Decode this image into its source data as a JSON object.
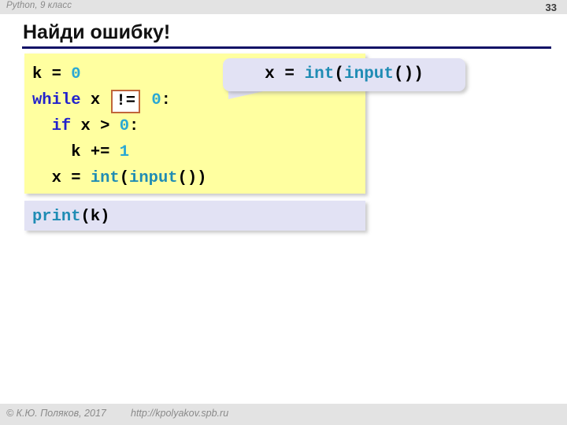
{
  "header": {
    "course_title": "Python, 9 класс",
    "page_number": "33"
  },
  "slide": {
    "title": "Найди ошибку!"
  },
  "code_main": {
    "lines": [
      {
        "indent": "",
        "tokens": [
          {
            "text": "k = ",
            "type": "plain"
          },
          {
            "text": "0",
            "type": "num"
          }
        ]
      },
      {
        "indent": "",
        "tokens": [
          {
            "text": "while",
            "type": "kw"
          },
          {
            "text": " x ",
            "type": "plain"
          },
          {
            "text": "!=",
            "type": "op-box"
          },
          {
            "text": " ",
            "type": "plain"
          },
          {
            "text": "0",
            "type": "num"
          },
          {
            "text": ":",
            "type": "plain"
          }
        ]
      },
      {
        "indent": "  ",
        "tokens": [
          {
            "text": "if",
            "type": "kw"
          },
          {
            "text": " x > ",
            "type": "plain"
          },
          {
            "text": "0",
            "type": "num"
          },
          {
            "text": ":",
            "type": "plain"
          }
        ]
      },
      {
        "indent": "    ",
        "tokens": [
          {
            "text": "k += ",
            "type": "plain"
          },
          {
            "text": "1",
            "type": "num"
          }
        ]
      },
      {
        "indent": "  ",
        "tokens": [
          {
            "text": "x = ",
            "type": "plain"
          },
          {
            "text": "int",
            "type": "fn"
          },
          {
            "text": "(",
            "type": "plain"
          },
          {
            "text": "input",
            "type": "fn"
          },
          {
            "text": "())",
            "type": "plain"
          }
        ]
      }
    ],
    "plain_text": "k = 0\nwhile x != 0:\n  if x > 0:\n    k += 1\n  x = int(input())"
  },
  "code_tail": {
    "lines": [
      {
        "indent": "",
        "tokens": [
          {
            "text": "print",
            "type": "fn"
          },
          {
            "text": "(k)",
            "type": "plain"
          }
        ]
      }
    ],
    "plain_text": "print(k)"
  },
  "callout": {
    "lines": [
      {
        "indent": "",
        "tokens": [
          {
            "text": "x = ",
            "type": "plain"
          },
          {
            "text": "int",
            "type": "fn"
          },
          {
            "text": "(",
            "type": "plain"
          },
          {
            "text": "input",
            "type": "fn"
          },
          {
            "text": "())",
            "type": "plain"
          }
        ]
      }
    ],
    "plain_text": "x = int(input())"
  },
  "footer": {
    "copyright": "© К.Ю. Поляков, 2017",
    "url": "http://kpolyakov.spb.ru"
  },
  "colors": {
    "bar_background": "#e3e3e3",
    "bar_text": "#8a8a8a",
    "title_text": "#111111",
    "title_rule": "#111166",
    "code_background": "#ffffa0",
    "callout_background": "#e2e2f4",
    "keyword": "#2222cc",
    "number": "#2aa8d4",
    "function": "#1f8cb4",
    "highlight_border": "#c0663a"
  }
}
